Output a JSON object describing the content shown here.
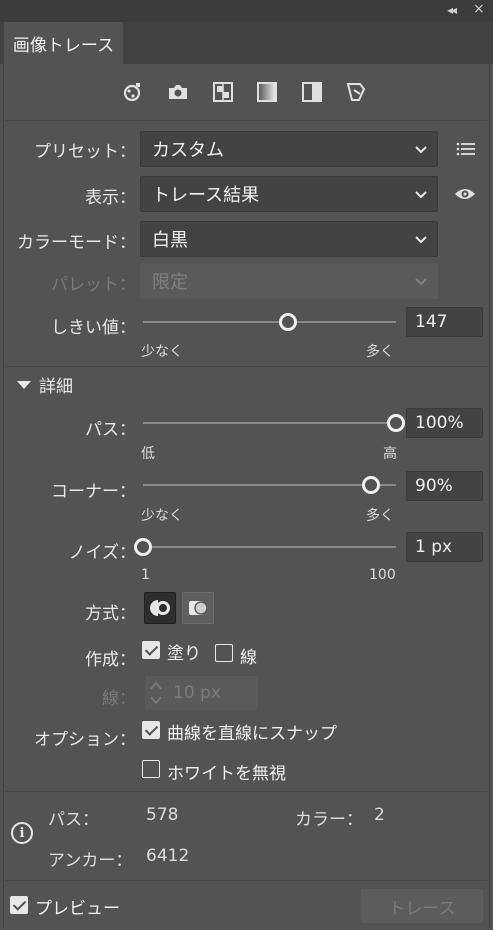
{
  "panel": {
    "tab_label": "画像トレース"
  },
  "preset_icons": [
    "auto-color-icon",
    "high-color-icon",
    "low-color-icon",
    "grayscale-icon",
    "black-white-icon",
    "outline-icon"
  ],
  "fields": {
    "preset_label": "プリセット：",
    "preset_value": "カスタム",
    "view_label": "表示：",
    "view_value": "トレース結果",
    "mode_label": "カラーモード：",
    "mode_value": "白黒",
    "palette_label": "パレット：",
    "palette_value": "限定",
    "threshold_label": "しきい値：",
    "threshold_value": "147",
    "threshold_min_label": "少なく",
    "threshold_max_label": "多く"
  },
  "threshold_fraction": 0.574,
  "advanced": {
    "title": "詳細",
    "paths_label": "パス：",
    "paths_value": "100%",
    "paths_min_label": "低",
    "paths_max_label": "高",
    "paths_fraction": 1.0,
    "corners_label": "コーナー：",
    "corners_value": "90%",
    "corners_min_label": "少なく",
    "corners_max_label": "多く",
    "corners_fraction": 0.9,
    "noise_label": "ノイズ：",
    "noise_value": "1 px",
    "noise_min_label": "1",
    "noise_max_label": "100",
    "noise_fraction": 0.0,
    "method_label": "方式：",
    "method_selected": "abutting",
    "create_label": "作成：",
    "fills_label": "塗り",
    "fills_checked": true,
    "strokes_label": "線",
    "strokes_checked": false,
    "stroke_label": "線：",
    "stroke_value": "10 px",
    "options_label": "オプション：",
    "snap_label": "曲線を直線にスナップ",
    "snap_checked": true,
    "ignore_white_label": "ホワイトを無視",
    "ignore_white_checked": false
  },
  "stats": {
    "paths_label": "パス：",
    "paths_value": "578",
    "colors_label": "カラー：",
    "colors_value": "2",
    "anchors_label": "アンカー：",
    "anchors_value": "6412"
  },
  "footer": {
    "preview_label": "プレビュー",
    "preview_checked": true,
    "trace_button": "トレース"
  }
}
